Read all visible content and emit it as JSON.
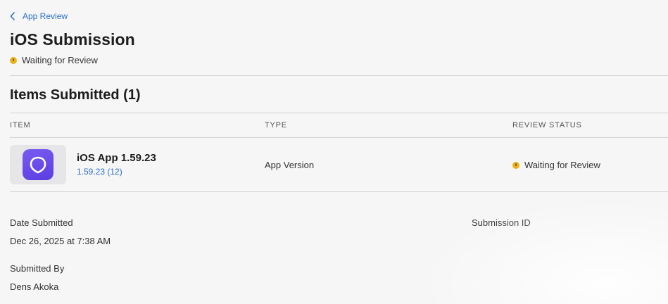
{
  "breadcrumb": {
    "label": "App Review"
  },
  "page": {
    "title": "iOS Submission",
    "status": "Waiting for Review",
    "status_color": "#e8b21e"
  },
  "items_section": {
    "title": "Items Submitted (1)",
    "columns": [
      "ITEM",
      "TYPE",
      "REVIEW STATUS"
    ],
    "rows": [
      {
        "icon": "app-logo-icon",
        "name": "iOS App 1.59.23",
        "version": "1.59.23 (12)",
        "type": "App Version",
        "review_status": "Waiting for Review"
      }
    ]
  },
  "details": {
    "date_submitted_label": "Date Submitted",
    "date_submitted_value": "Dec 26, 2025 at 7:38 AM",
    "submission_id_label": "Submission ID",
    "submitted_by_label": "Submitted By",
    "submitted_by_value": "Dens Akoka"
  },
  "colors": {
    "link": "#2c6fc9",
    "app_icon": "#6a4ae8",
    "background": "#f6f6f6"
  }
}
